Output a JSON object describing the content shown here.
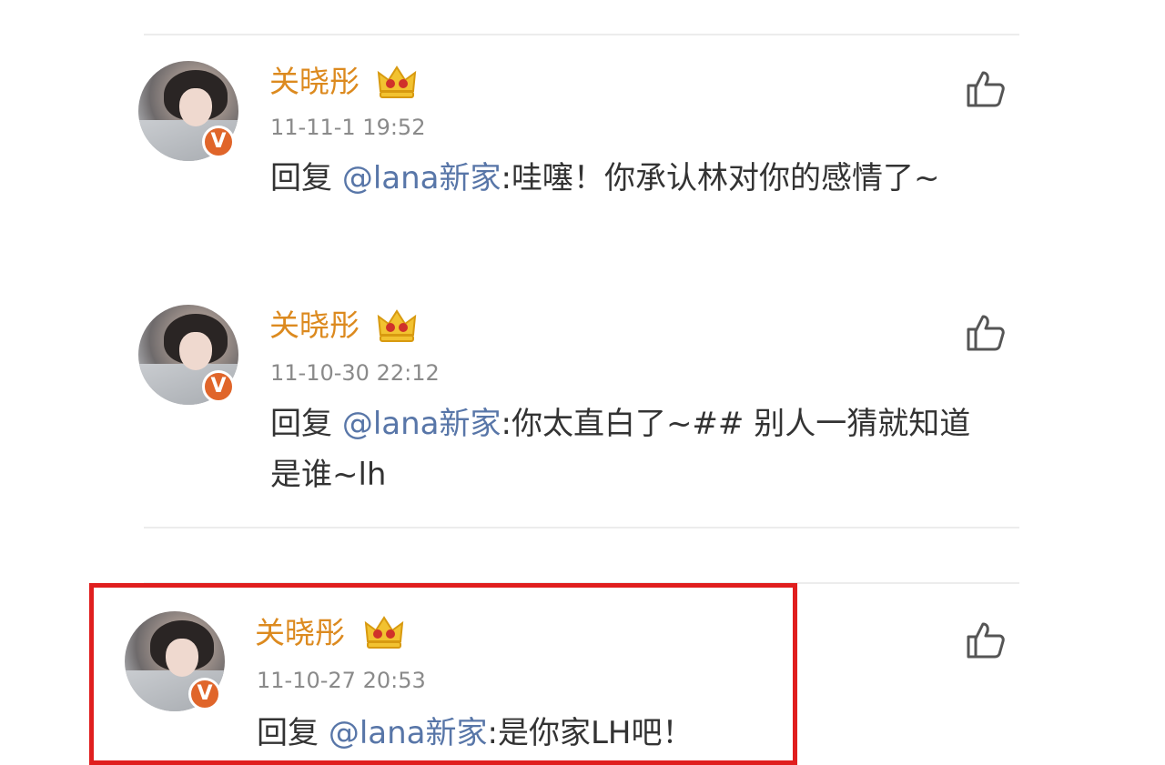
{
  "comments": [
    {
      "author": "关晓彤",
      "verified_badge": "V",
      "timestamp": "11-11-1 19:52",
      "reply_prefix": "回复 ",
      "mention": "@lana新家",
      "body": ":哇噻！你承认林对你的感情了~",
      "icons": {
        "crown": "crown-icon",
        "like": "thumbs-up-icon"
      }
    },
    {
      "author": "关晓彤",
      "verified_badge": "V",
      "timestamp": "11-10-30 22:12",
      "reply_prefix": "回复 ",
      "mention": "@lana新家",
      "body": ":你太直白了~## 别人一猜就知道是谁~lh",
      "icons": {
        "crown": "crown-icon",
        "like": "thumbs-up-icon"
      }
    },
    {
      "author": "关晓彤",
      "verified_badge": "V",
      "timestamp": "11-10-27 20:53",
      "reply_prefix": "回复 ",
      "mention": "@lana新家",
      "body": ":是你家LH吧！",
      "highlighted": true,
      "icons": {
        "crown": "crown-icon",
        "like": "thumbs-up-icon"
      }
    }
  ],
  "colors": {
    "author_name": "#dc8a1f",
    "mention": "#5876a8",
    "highlight_border": "#e01e1e",
    "verified_badge": "#e0652a"
  }
}
